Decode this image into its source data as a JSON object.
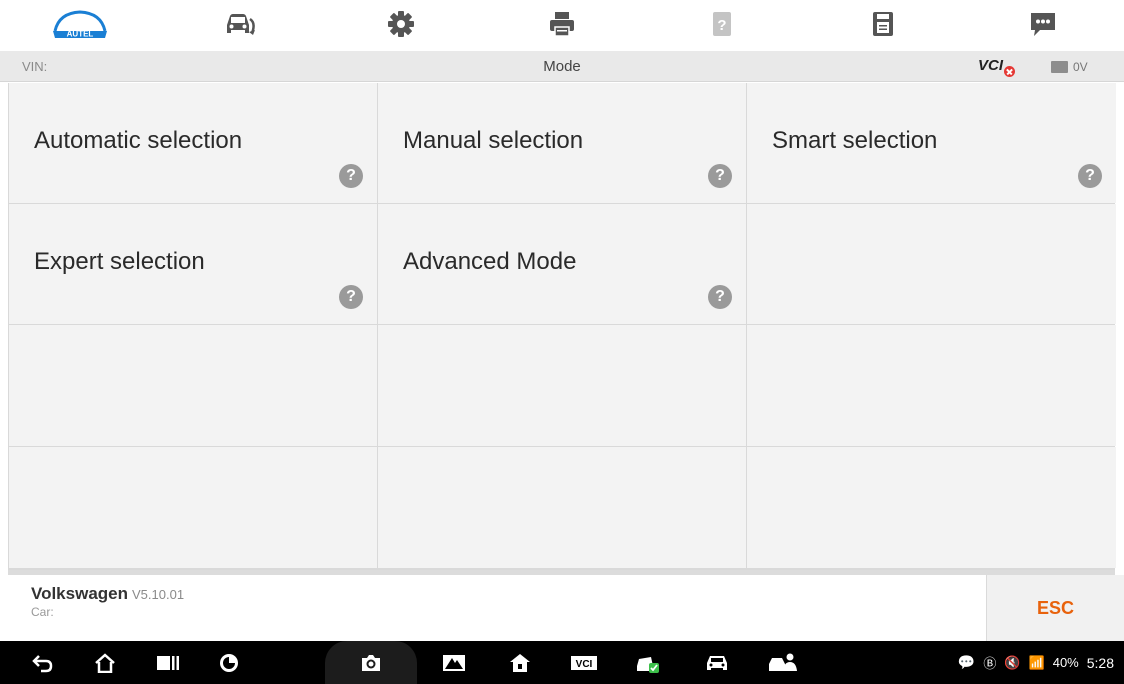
{
  "toolbar": {
    "items": [
      {
        "name": "autel-home-button",
        "icon": "autel-logo",
        "label": "AUTEL"
      },
      {
        "name": "vehicle-swap-button",
        "icon": "car-swap-icon"
      },
      {
        "name": "settings-button",
        "icon": "gear-icon"
      },
      {
        "name": "print-button",
        "icon": "printer-icon"
      },
      {
        "name": "help-button",
        "icon": "help-doc-icon"
      },
      {
        "name": "save-button",
        "icon": "save-icon"
      },
      {
        "name": "feedback-button",
        "icon": "chat-icon"
      }
    ]
  },
  "infobar": {
    "vin_label": "VIN:",
    "title": "Mode",
    "vci_label": "VCI",
    "voltage": "0V"
  },
  "modes": [
    {
      "label": "Automatic selection",
      "help": "?"
    },
    {
      "label": "Manual selection",
      "help": "?"
    },
    {
      "label": "Smart selection",
      "help": "?"
    },
    {
      "label": "Expert selection",
      "help": "?"
    },
    {
      "label": "Advanced Mode",
      "help": "?"
    }
  ],
  "footer": {
    "make": "Volkswagen",
    "version": "V5.10.01",
    "car_label": "Car:",
    "esc_label": "ESC"
  },
  "statusbar": {
    "battery": "40%",
    "time": "5:28"
  },
  "colors": {
    "accent": "#e8620c",
    "autel_blue": "#1a7fd4",
    "vci_error": "#e53935"
  }
}
